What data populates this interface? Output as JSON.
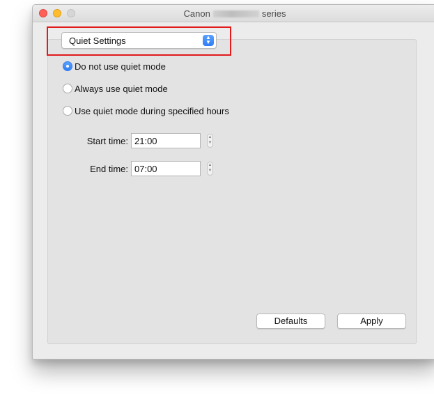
{
  "window": {
    "title_left": "Canon",
    "title_right": "series"
  },
  "popup": {
    "selected": "Quiet Settings"
  },
  "quiet_mode": {
    "options": [
      {
        "label": "Do not use quiet mode",
        "selected": true
      },
      {
        "label": "Always use quiet mode",
        "selected": false
      },
      {
        "label": "Use quiet mode during specified hours",
        "selected": false
      }
    ]
  },
  "schedule": {
    "start_label": "Start time:",
    "start_value": "21:00",
    "end_label": "End time:",
    "end_value": "07:00"
  },
  "buttons": {
    "defaults": "Defaults",
    "apply": "Apply"
  },
  "colors": {
    "accent": "#2f7df6",
    "highlight": "#e21a1a"
  }
}
